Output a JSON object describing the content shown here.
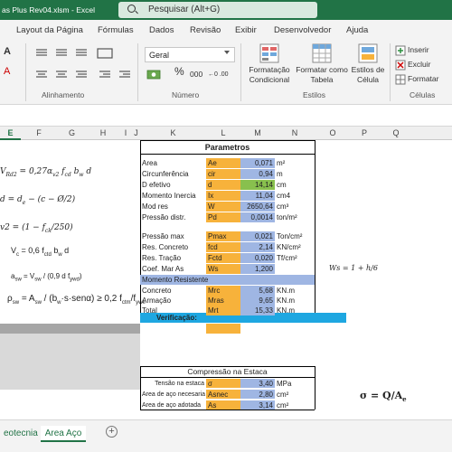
{
  "titlebar": {
    "title": "as Plus Rev04.xlsm  -  Excel",
    "search_placeholder": "Pesquisar (Alt+G)"
  },
  "ribbon_tabs": [
    "Layout da Página",
    "Fórmulas",
    "Dados",
    "Revisão",
    "Exibir",
    "Desenvolvedor",
    "Ajuda"
  ],
  "ribbon": {
    "number_format": "Geral",
    "percent": "%",
    "thousands": "000",
    "align_group": "Alinhamento",
    "number_group": "Número",
    "styles_group": "Estilos",
    "cells_group": "Células",
    "cond_format": [
      "Formatação",
      "Condicional"
    ],
    "format_table": [
      "Formatar como",
      "Tabela"
    ],
    "cell_styles": [
      "Estilos de",
      "Célula"
    ],
    "insert": "Inserir",
    "delete": "Excluir",
    "format": "Formatar",
    "font_a": "A",
    "dec_inc": "←0 .00",
    "dec_dec": ".00 →0"
  },
  "columns": [
    "E",
    "F",
    "G",
    "H",
    "I",
    "J",
    "K",
    "L",
    "M",
    "N",
    "O",
    "P",
    "Q"
  ],
  "params": {
    "title": "Parametros",
    "rows": [
      {
        "label": "Area",
        "sym": "Ae",
        "val": "0,071",
        "unit": "m²"
      },
      {
        "label": "Circunferência",
        "sym": "cir",
        "val": "0,94",
        "unit": "m"
      },
      {
        "label": "D efetivo",
        "sym": "d",
        "val": "14,14",
        "unit": "cm"
      },
      {
        "label": "Momento Inercia",
        "sym": "Ix",
        "val": "11,04",
        "unit": "cm4"
      },
      {
        "label": "Mod res",
        "sym": "W",
        "val": "2650,64",
        "unit": "cm³"
      },
      {
        "label": "Pressão distr.",
        "sym": "Pd",
        "val": "0,0014",
        "unit": "ton/m²"
      },
      {
        "label": "Pressão max",
        "sym": "Pmax",
        "val": "0,021",
        "unit": "Ton/cm²"
      },
      {
        "label": "Res. Concreto",
        "sym": "fcd",
        "val": "2,14",
        "unit": "KN/cm²"
      },
      {
        "label": "Res. Tração",
        "sym": "Fctd",
        "val": "0,020",
        "unit": "Tf/cm²"
      },
      {
        "label": "Coef. Mar As",
        "sym": "Ws",
        "val": "1,200",
        "unit": ""
      }
    ],
    "moment_title": "Momento Resistente",
    "moment_rows": [
      {
        "label": "Concreto",
        "sym": "Mrc",
        "val": "5,68",
        "unit": "KN.m"
      },
      {
        "label": "Armação",
        "sym": "Mras",
        "val": "9,65",
        "unit": "KN.m"
      },
      {
        "label": "Total",
        "sym": "Mrt",
        "val": "15,33",
        "unit": "KN.m"
      }
    ],
    "verification": "Verificação:"
  },
  "compression": {
    "title": "Compressão na Estaca",
    "rows": [
      {
        "label": "Tensão na estaca",
        "sym": "σ",
        "val": "3,40",
        "unit": "MPa"
      },
      {
        "label": "Area de aço necesaria",
        "sym": "Asnec",
        "val": "2,80",
        "unit": "cm²"
      },
      {
        "label": "Area de aço adotada",
        "sym": "As",
        "val": "3,14",
        "unit": "cm²"
      }
    ]
  },
  "formulas": {
    "f1": "V_Rd2 = 0,27 α_v2 f_cd b_w d",
    "f2": "d = d_e − (c − Ø/2)",
    "f3": "α_v2 = (1 − f_ck/250)",
    "f4": "V_c = 0,6 f_ctd b_w d",
    "f5": "a_sw = V_sw / (0,9 d f_ywd)",
    "f6": "ρ_sw = A_sw / (b_w · s · sen α) ≥ 0,2 f_ctm / f_ywk",
    "ws": "Ws = 1 + h/6",
    "sigma": "σ = Q / A_e"
  },
  "sheet_tabs": [
    "eotecnia",
    "Area Aço"
  ],
  "add_sheet": "+",
  "colors": {
    "excel_green": "#217346",
    "orange": "#f7b23b",
    "blue": "#9fb6e3",
    "green": "#88c04e",
    "cyan": "#1ea7e1"
  }
}
